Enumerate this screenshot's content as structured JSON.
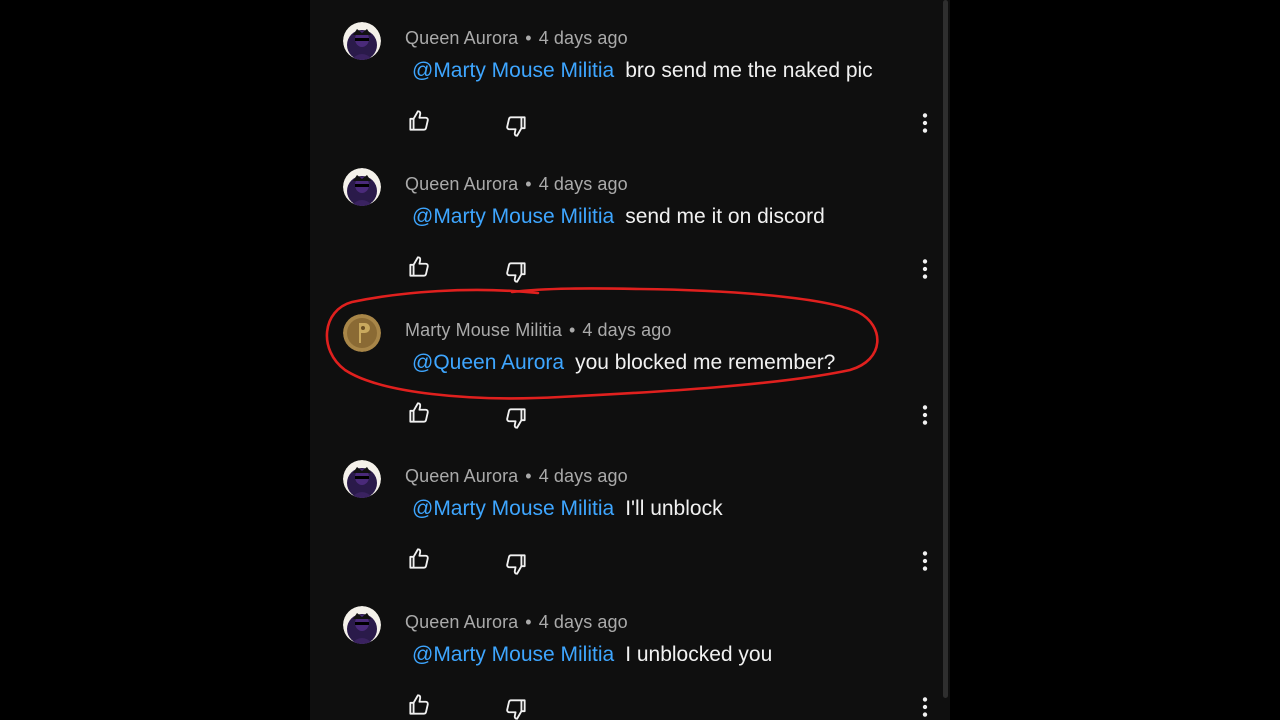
{
  "colors": {
    "page_bg": "#000000",
    "panel_bg": "#0f0f0f",
    "meta_text": "#aaaaaa",
    "body_text": "#f1f1f1",
    "mention": "#3ea6ff",
    "annotation": "#e0201e"
  },
  "comments": [
    {
      "author": "Queen Aurora",
      "time": "4 days ago",
      "mention": "@Marty Mouse Militia",
      "text": "bro send me the naked pic",
      "avatar": "queen-aurora-avatar"
    },
    {
      "author": "Queen Aurora",
      "time": "4 days ago",
      "mention": "@Marty Mouse Militia",
      "text": "send me it on discord",
      "avatar": "queen-aurora-avatar"
    },
    {
      "author": "Marty Mouse Militia",
      "time": "4 days ago",
      "mention": "@Queen Aurora",
      "text": "you blocked me remember?",
      "avatar": "marty-mouse-militia-avatar"
    },
    {
      "author": "Queen Aurora",
      "time": "4 days ago",
      "mention": "@Marty Mouse Militia",
      "text": "I'll unblock",
      "avatar": "queen-aurora-avatar"
    },
    {
      "author": "Queen Aurora",
      "time": "4 days ago",
      "mention": "@Marty Mouse Militia",
      "text": "I unblocked you",
      "avatar": "queen-aurora-avatar"
    }
  ],
  "icons": {
    "like": "thumbs-up-icon",
    "dislike": "thumbs-down-icon",
    "menu": "more-vertical-icon"
  },
  "separator": "•"
}
